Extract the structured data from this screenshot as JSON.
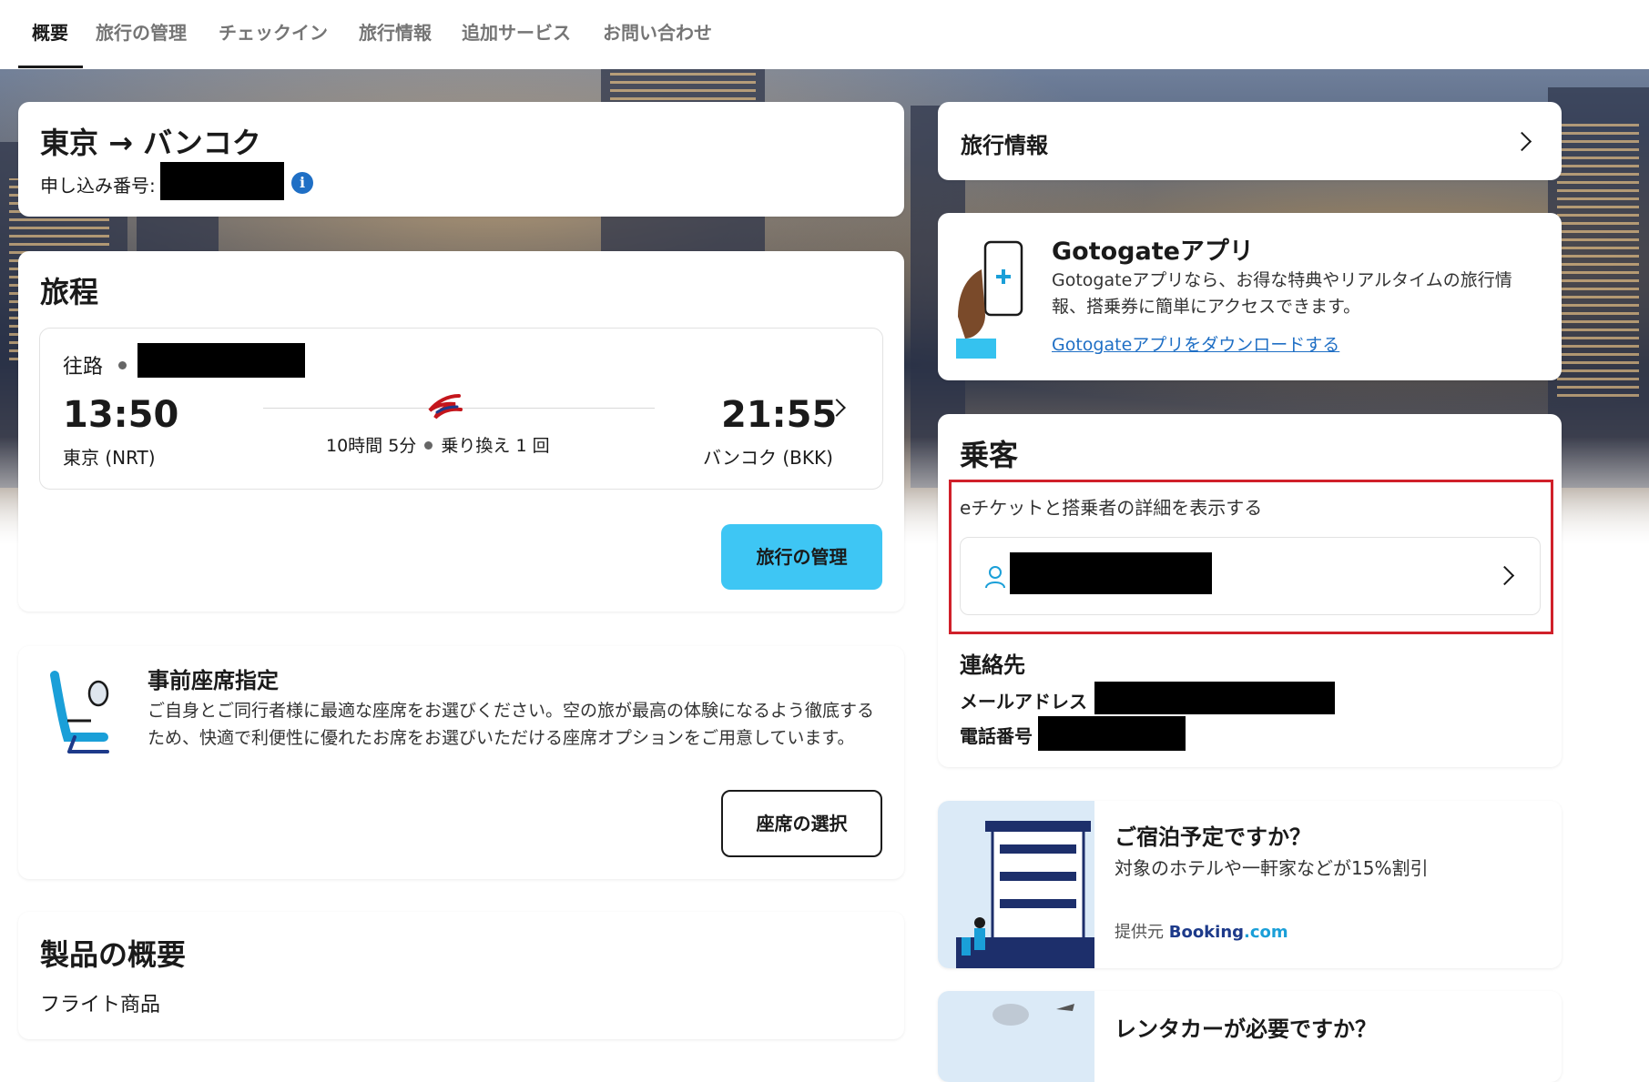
{
  "nav": {
    "tabs": [
      "概要",
      "旅行の管理",
      "チェックイン",
      "旅行情報",
      "追加サービス",
      "お問い合わせ"
    ]
  },
  "route": {
    "title": "東京 → バンコク",
    "booking_label": "申し込み番号:"
  },
  "itinerary": {
    "heading": "旅程",
    "direction": "往路",
    "dep_time": "13:50",
    "dep_place": "東京 (NRT)",
    "arr_time": "21:55",
    "arr_place": "バンコク (BKK)",
    "duration": "10時間 5分",
    "transfers": "乗り換え 1 回",
    "manage_button": "旅行の管理"
  },
  "seat": {
    "heading": "事前座席指定",
    "description": "ご自身とご同行者様に最適な座席をお選びください。空の旅が最高の体験になるよう徹底するため、快適で利便性に優れたお席をお選びいただける座席オプションをご用意しています。",
    "button": "座席の選択"
  },
  "product": {
    "heading": "製品の概要",
    "item": "フライト商品"
  },
  "travel_info": {
    "label": "旅行情報"
  },
  "app": {
    "title": "Gotogateアプリ",
    "description": "Gotogateアプリなら、お得な特典やリアルタイムの旅行情報、搭乗券に簡単にアクセスできます。",
    "link": "Gotogateアプリをダウンロードする"
  },
  "passenger": {
    "heading": "乗客",
    "subtitle": "eチケットと搭乗者の詳細を表示する",
    "contact_heading": "連絡先",
    "email_label": "メールアドレス",
    "phone_label": "電話番号"
  },
  "hotel": {
    "title": "ご宿泊予定ですか？",
    "description": "対象のホテルや一軒家などが15%割引",
    "provider_label": "提供元",
    "provider_name_a": "Booking",
    "provider_name_b": ".com"
  },
  "car": {
    "title": "レンタカーが必要ですか？"
  },
  "colors": {
    "accent": "#3ec6f4",
    "highlight_border": "#d0202a",
    "link": "#1f6fc5",
    "booking": "#1d3a8a"
  }
}
